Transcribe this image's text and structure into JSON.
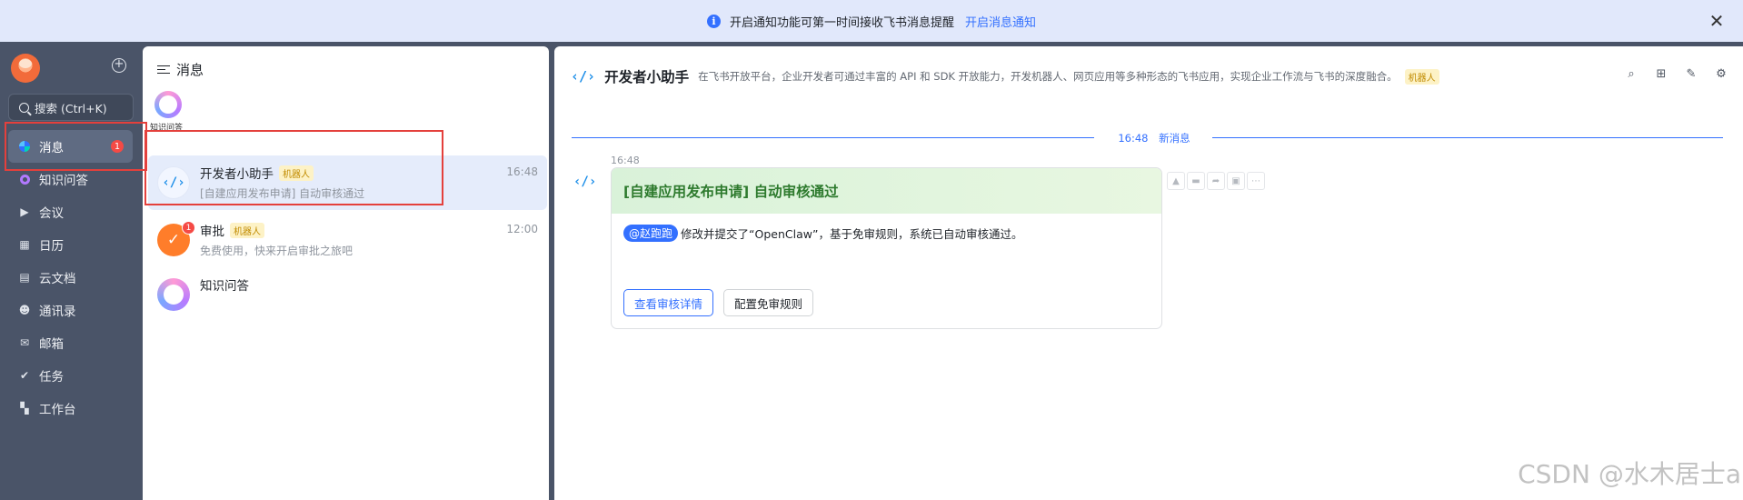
{
  "banner": {
    "text": "开启通知功能可第一时间接收飞书消息提醒",
    "link": "开启消息通知",
    "info_icon": "info-icon",
    "close_icon": "close-icon"
  },
  "nav": {
    "search_label": "搜索 (Ctrl+K)",
    "items": [
      {
        "label": "消息",
        "icon": "message-icon",
        "badge": "1"
      },
      {
        "label": "知识问答",
        "icon": "knowledge-icon"
      },
      {
        "label": "会议",
        "icon": "video-icon"
      },
      {
        "label": "日历",
        "icon": "calendar-icon"
      },
      {
        "label": "云文档",
        "icon": "doc-icon"
      },
      {
        "label": "通讯录",
        "icon": "contacts-icon"
      },
      {
        "label": "邮箱",
        "icon": "mail-icon"
      },
      {
        "label": "任务",
        "icon": "check-icon"
      },
      {
        "label": "工作台",
        "icon": "apps-icon"
      }
    ]
  },
  "chat_list": {
    "title": "消息",
    "pinned_label": "知识问答",
    "chats": [
      {
        "name": "开发者小助手",
        "tag": "机器人",
        "preview": "[自建应用发布申请] 自动审核通过",
        "time": "16:48"
      },
      {
        "name": "审批",
        "tag": "机器人",
        "preview": "免费使用，快来开启审批之旅吧",
        "time": "12:00",
        "badge": "1"
      },
      {
        "name": "知识问答",
        "tag": "",
        "preview": "",
        "time": ""
      }
    ]
  },
  "conversation": {
    "title": "开发者小助手",
    "description": "在飞书开放平台，企业开发者可通过丰富的 API 和 SDK 开放能力，开发机器人、网页应用等多种形态的飞书应用，实现企业工作流与飞书的深度融合。",
    "tag": "机器人",
    "divider_time": "16:48",
    "divider_label": "新消息",
    "message_time": "16:48",
    "card": {
      "title": "[自建应用发布申请] 自动审核通过",
      "mention": "@赵跑跑",
      "body": "修改并提交了“OpenClaw”，基于免审规则，系统已自动审核通过。",
      "primary_button": "查看审核详情",
      "secondary_button": "配置免审规则"
    }
  },
  "watermark": "CSDN @水木居士a",
  "colors": {
    "accent": "#3370ff",
    "nav_bg": "#4a5468",
    "badge": "#f54a45",
    "highlight_box": "#e4403c",
    "card_title": "#2d7a2d"
  }
}
